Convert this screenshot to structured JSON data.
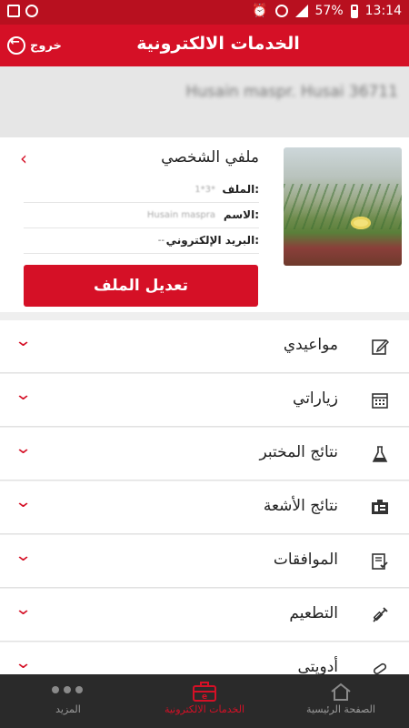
{
  "status": {
    "time": "13:14",
    "battery": "57%"
  },
  "appbar": {
    "title": "الخدمات الالكترونية",
    "exit_label": "خروج"
  },
  "user": {
    "name_blurred": "Husain maspr. Husai 36711"
  },
  "profile": {
    "title": "ملفي الشخصي",
    "rows": [
      {
        "label": "الملف:",
        "value": "1*3*"
      },
      {
        "label": "الاسم:",
        "value": "Husain maspra"
      },
      {
        "label": "البريد الإلكتروني:",
        "value": "--"
      }
    ],
    "edit_button": "تعديل الملف"
  },
  "menu": [
    {
      "label": "مواعيدي",
      "icon": "edit-icon"
    },
    {
      "label": "زياراتي",
      "icon": "calendar-icon"
    },
    {
      "label": "نتائج المختبر",
      "icon": "flask-icon"
    },
    {
      "label": "نتائج الأشعة",
      "icon": "xray-icon"
    },
    {
      "label": "الموافقات",
      "icon": "approval-icon"
    },
    {
      "label": "التطعيم",
      "icon": "syringe-icon"
    },
    {
      "label": "أدويتي",
      "icon": "pill-icon"
    }
  ],
  "bottom_nav": {
    "more": "المزيد",
    "eservices": "الخدمات الالكترونية",
    "home": "الصفحة الرئيسية"
  },
  "colors": {
    "primary": "#d51026",
    "statusbar": "#b8101f",
    "nav_bg": "#2a2a2a"
  }
}
